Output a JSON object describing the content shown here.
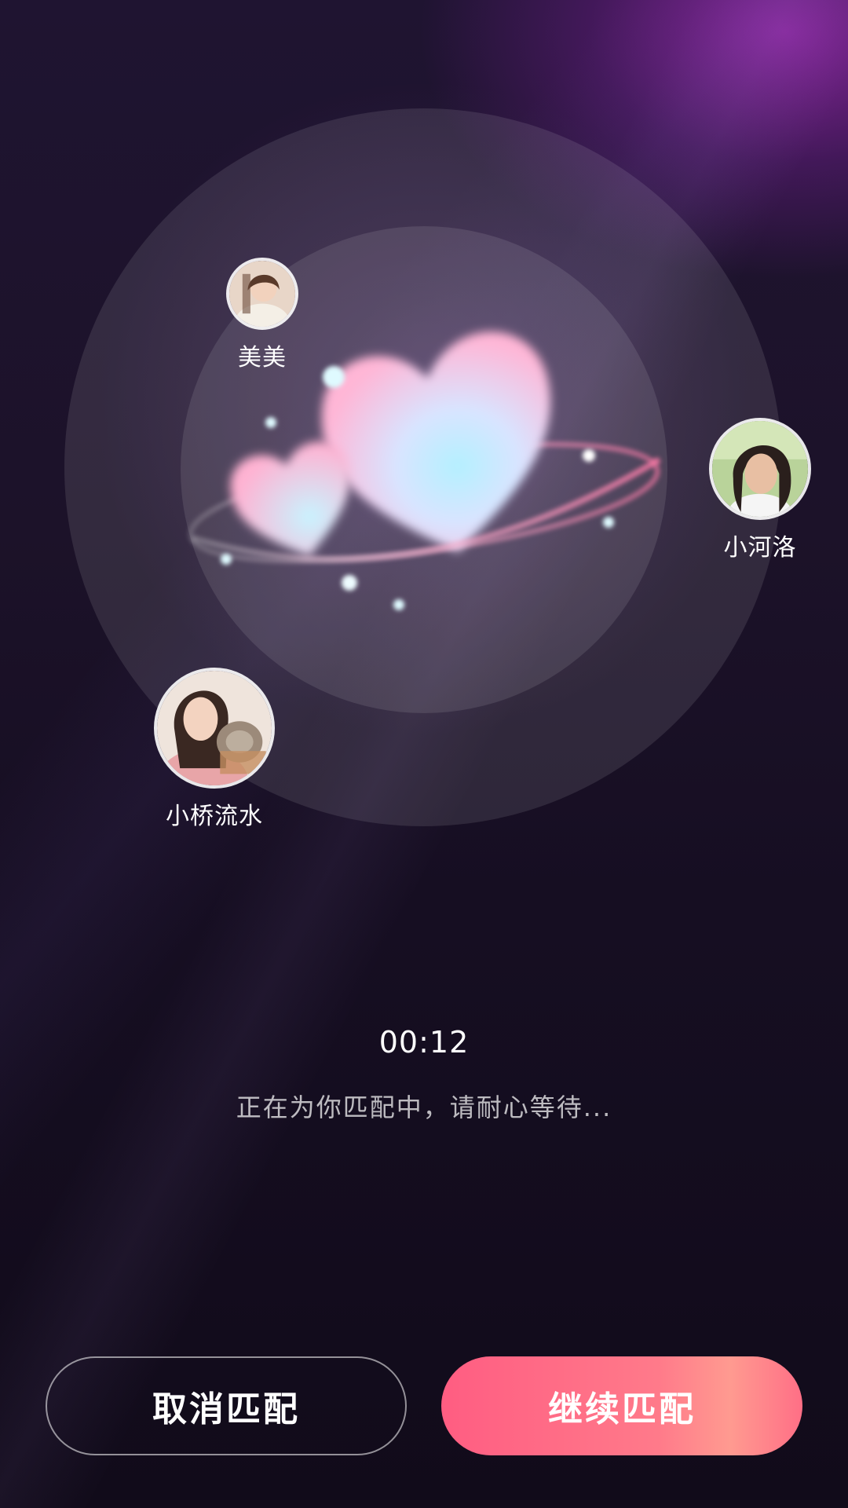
{
  "radar": {
    "users": [
      {
        "name": "美美",
        "avatar_icon": "user-avatar-photo"
      },
      {
        "name": "小河洛",
        "avatar_icon": "user-avatar-photo"
      },
      {
        "name": "小桥流水",
        "avatar_icon": "user-avatar-photo"
      }
    ]
  },
  "match": {
    "timer": "00:12",
    "status_text": "正在为你匹配中，请耐心等待..."
  },
  "buttons": {
    "cancel_label": "取消匹配",
    "continue_label": "继续匹配"
  },
  "colors": {
    "accent": "#ff5d82",
    "heart_pink": "#ffb6d6",
    "heart_cyan": "#b4f0ff"
  }
}
